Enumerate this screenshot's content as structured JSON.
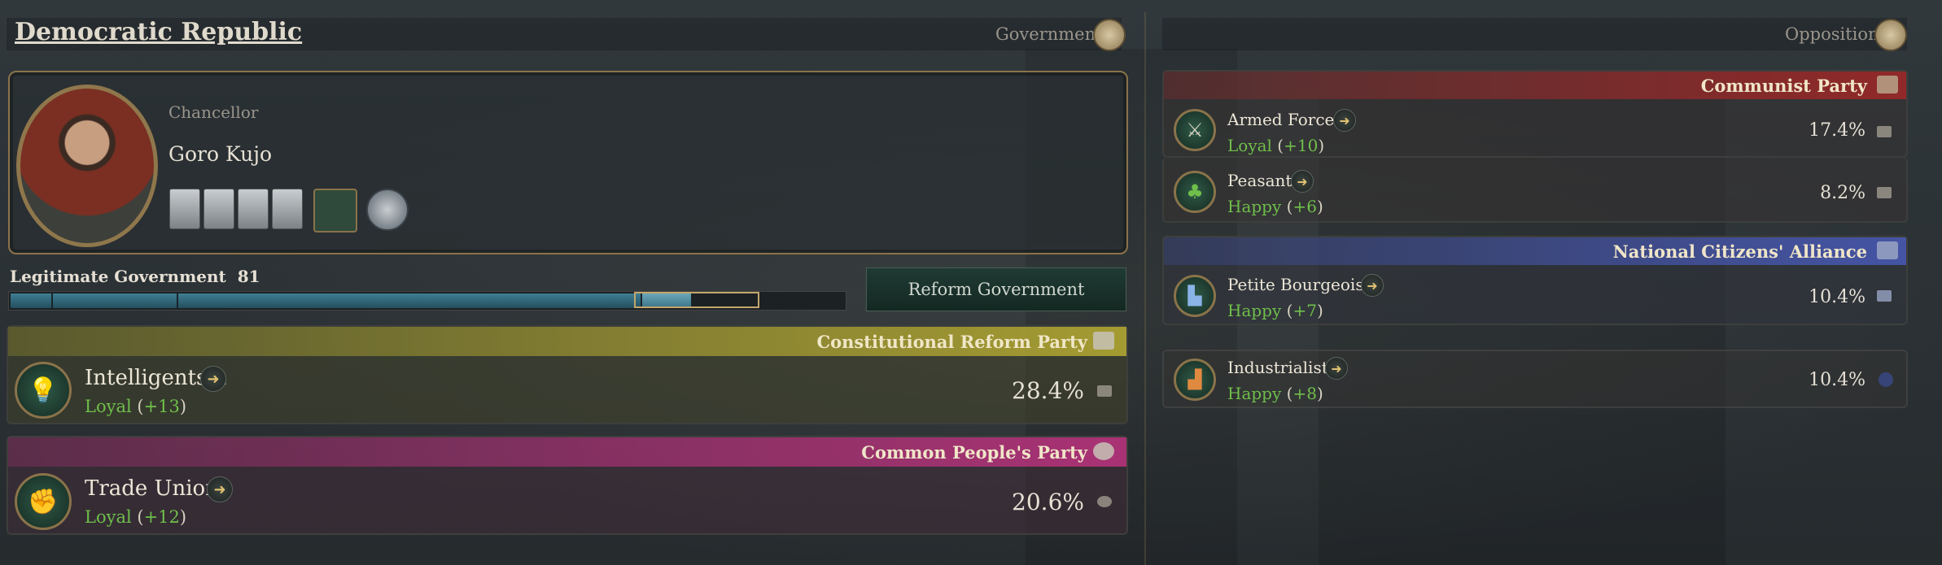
{
  "title": "Democratic Republic",
  "government": {
    "label": "Government"
  },
  "opposition": {
    "label": "Opposition"
  },
  "leader": {
    "role": "Chancellor",
    "name": "Goro Kujo"
  },
  "legitimacy": {
    "label": "Legitimate Government",
    "value": "81",
    "fraction": 0.81
  },
  "reform_button": "Reform Government",
  "gov_parties": [
    {
      "name": "Constitutional Reform Party",
      "color": "#9a9430",
      "groups": [
        {
          "name": "Intelligentsia",
          "status": "Loyal",
          "modifier": "+13",
          "percent": "28.4%"
        }
      ]
    },
    {
      "name": "Common People's Party",
      "color": "#a03070",
      "groups": [
        {
          "name": "Trade Unions",
          "status": "Loyal",
          "modifier": "+12",
          "percent": "20.6%"
        }
      ]
    }
  ],
  "opp_parties": [
    {
      "name": "Communist Party",
      "color": "#8a2a2a",
      "groups": [
        {
          "name": "Armed Forces",
          "status": "Loyal",
          "modifier": "+10",
          "percent": "17.4%"
        },
        {
          "name": "Peasants",
          "status": "Happy",
          "modifier": "+6",
          "percent": "8.2%"
        }
      ]
    },
    {
      "name": "National Citizens' Alliance",
      "color": "#3e4ea0",
      "groups": [
        {
          "name": "Petite Bourgeoisie",
          "status": "Happy",
          "modifier": "+7",
          "percent": "10.4%"
        }
      ]
    }
  ],
  "independents": [
    {
      "name": "Industrialists",
      "status": "Happy",
      "modifier": "+8",
      "percent": "10.4%"
    }
  ],
  "icons": {
    "arrow": "arrow-right-icon",
    "lightbulb": "lightbulb-icon",
    "crossed_swords": "crossed-swords-icon",
    "tree": "tree-icon",
    "buildings": "buildings-icon",
    "factory": "factory-icon",
    "fist": "fist-icon"
  }
}
